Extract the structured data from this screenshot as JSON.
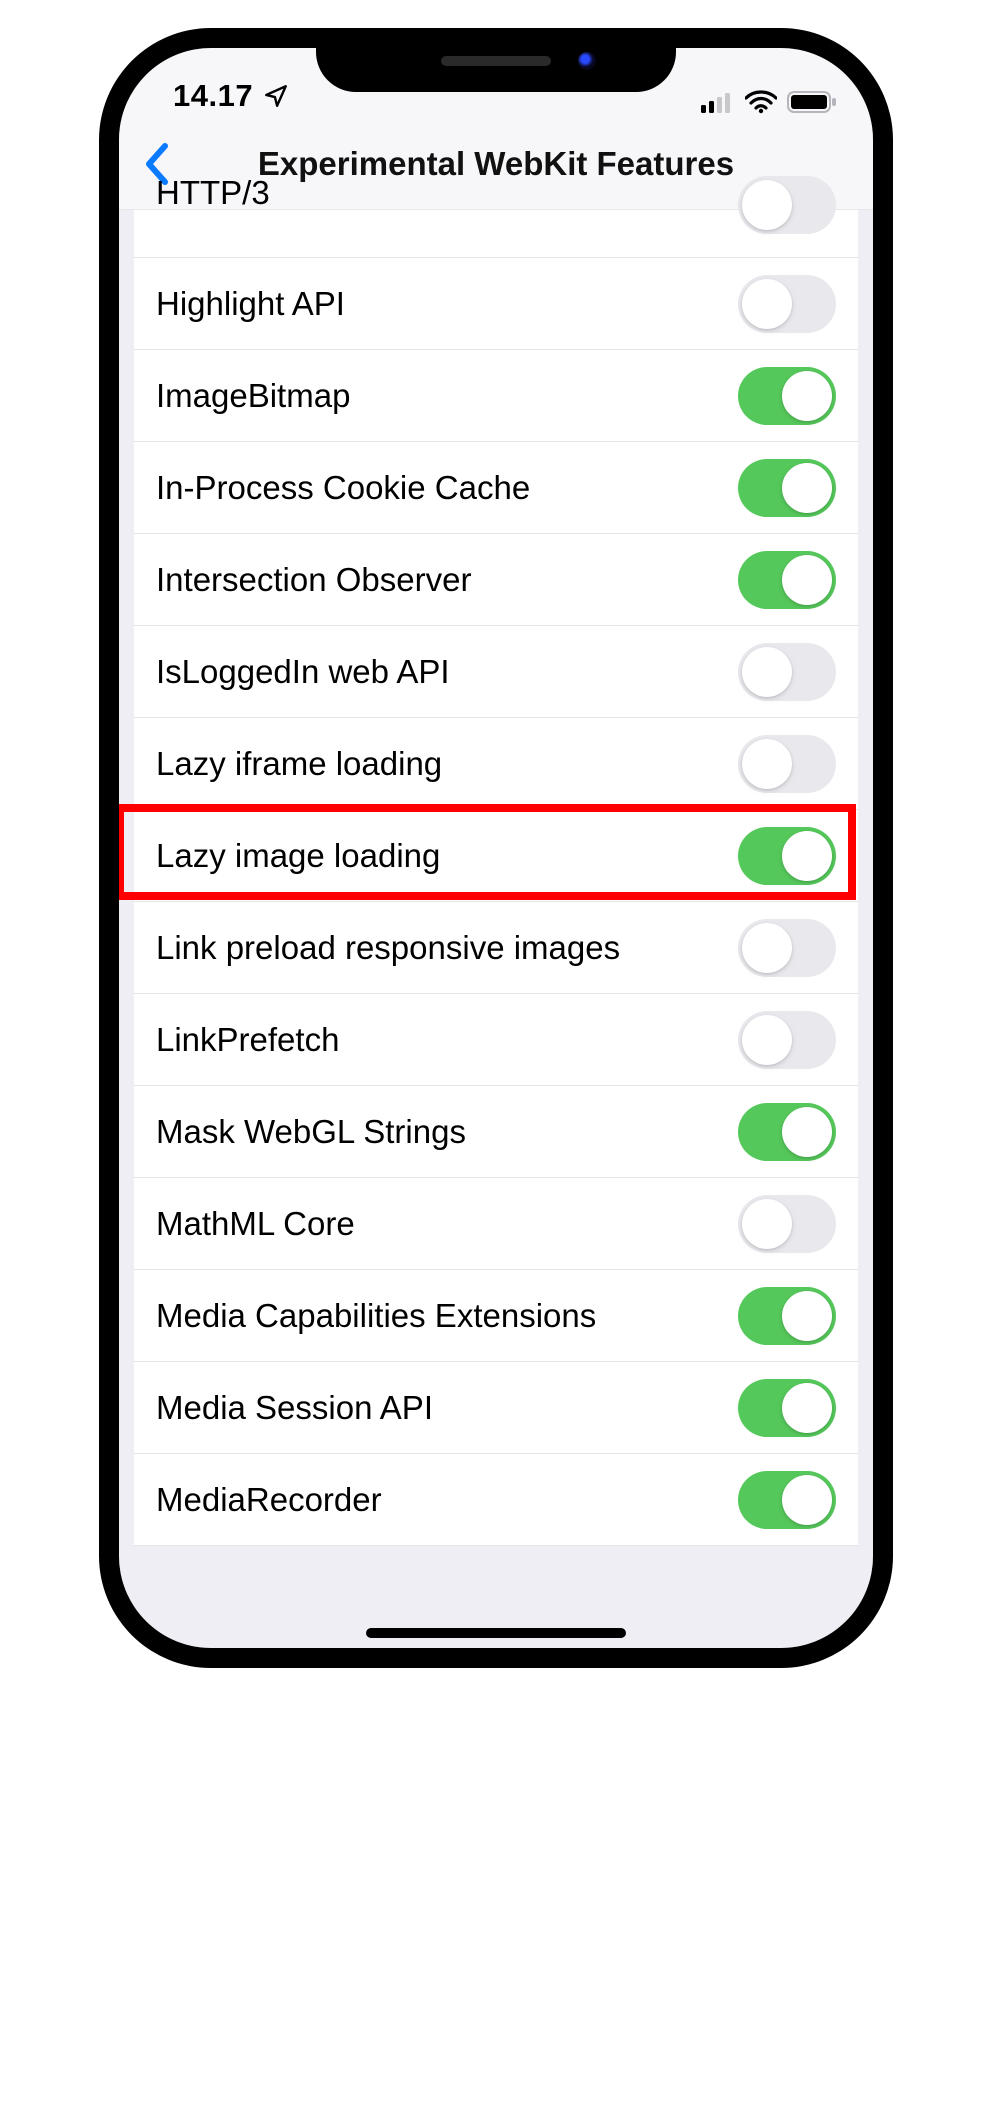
{
  "status_bar": {
    "time": "14.17"
  },
  "nav": {
    "title": "Experimental WebKit Features"
  },
  "settings": [
    {
      "label": "HTTP/3",
      "on": false,
      "partial": true
    },
    {
      "label": "Highlight API",
      "on": false
    },
    {
      "label": "ImageBitmap",
      "on": true
    },
    {
      "label": "In-Process Cookie Cache",
      "on": true
    },
    {
      "label": "Intersection Observer",
      "on": true
    },
    {
      "label": "IsLoggedIn web API",
      "on": false
    },
    {
      "label": "Lazy iframe loading",
      "on": false
    },
    {
      "label": "Lazy image loading",
      "on": true,
      "highlighted": true
    },
    {
      "label": "Link preload responsive images",
      "on": false
    },
    {
      "label": "LinkPrefetch",
      "on": false
    },
    {
      "label": "Mask WebGL Strings",
      "on": true
    },
    {
      "label": "MathML Core",
      "on": false
    },
    {
      "label": "Media Capabilities Extensions",
      "on": true
    },
    {
      "label": "Media Session API",
      "on": true
    },
    {
      "label": "MediaRecorder",
      "on": true
    }
  ]
}
